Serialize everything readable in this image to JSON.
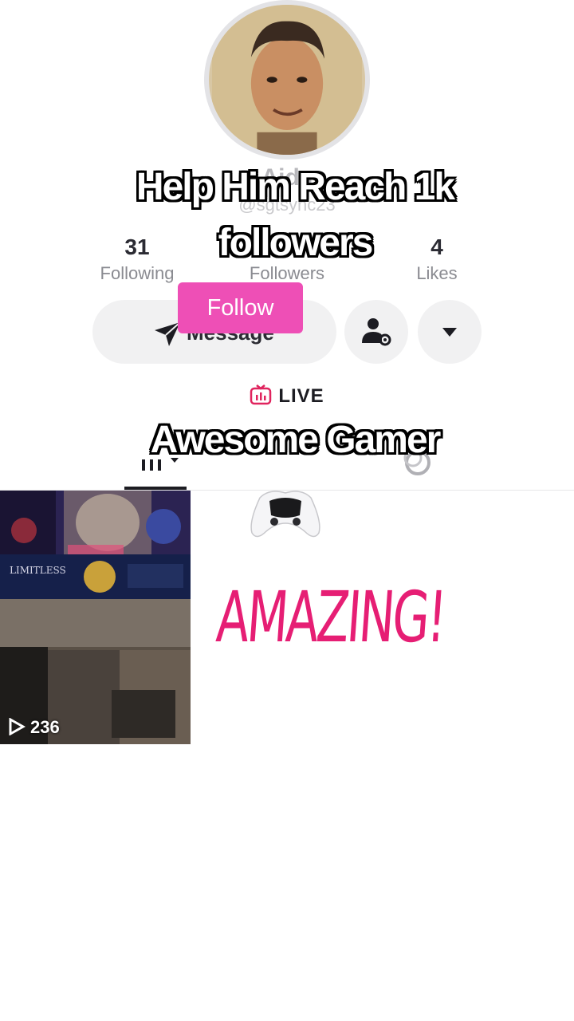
{
  "profile": {
    "name": "Aida",
    "handle": "@sgtsync23",
    "stats": {
      "following_count": "31",
      "following_label": "Following",
      "followers_label": "Followers",
      "likes_count": "4",
      "likes_label": "Likes"
    }
  },
  "actions": {
    "message_label": "Message",
    "follow_label": "Follow"
  },
  "tabs": {
    "live_label": "LIVE"
  },
  "overlays": {
    "line1": "Help Him Reach 1k",
    "line2": "followers",
    "line3": "Awesome  Gamer",
    "sticker": "AMAZING!"
  },
  "videos": [
    {
      "views": "236"
    }
  ],
  "colors": {
    "follow_pink": "#ee4fb6",
    "sticker_pink": "#e61e74",
    "live_icon": "#e0245e"
  }
}
